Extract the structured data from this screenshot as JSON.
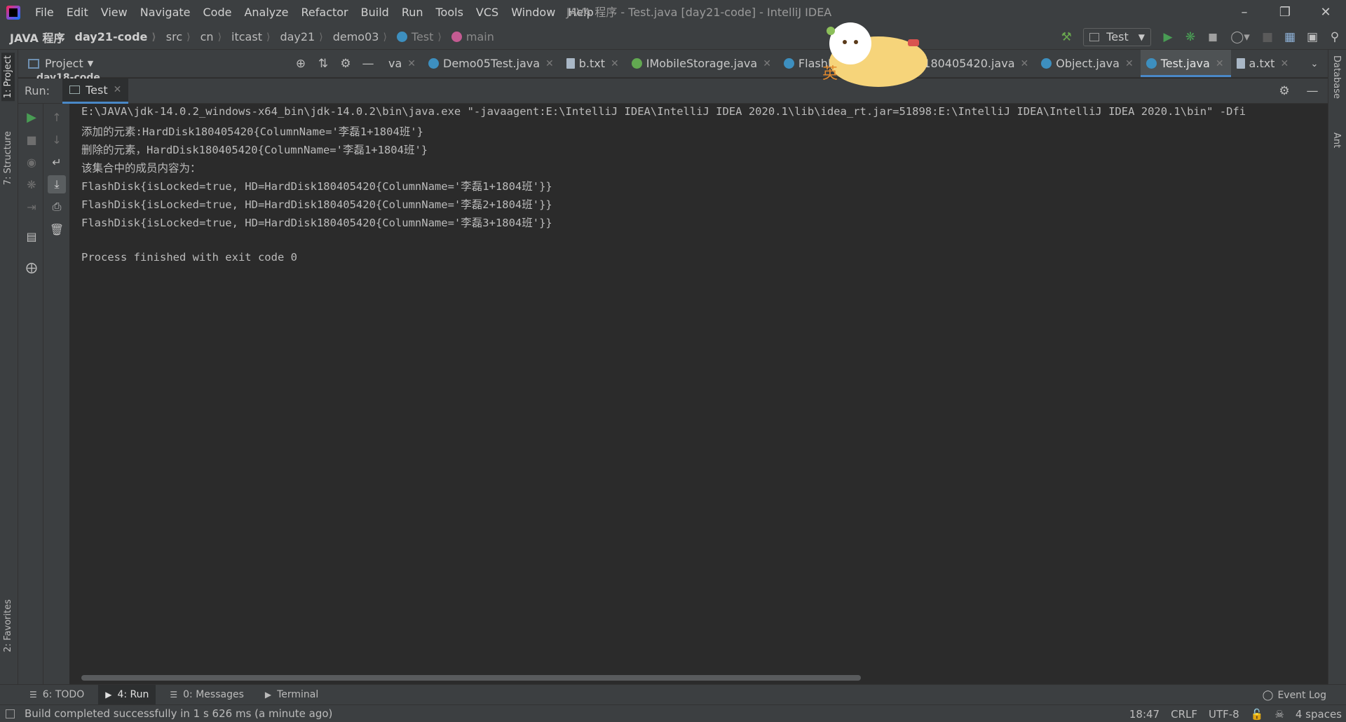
{
  "menu": {
    "items": [
      "File",
      "Edit",
      "View",
      "Navigate",
      "Code",
      "Analyze",
      "Refactor",
      "Build",
      "Run",
      "Tools",
      "VCS",
      "Window",
      "Help"
    ],
    "window_title": "JAVA 程序 - Test.java [day21-code] - IntelliJ IDEA"
  },
  "breadcrumb": {
    "items": [
      "JAVA 程序",
      "day21-code",
      "src",
      "cn",
      "itcast",
      "day21",
      "demo03",
      "Test",
      "main"
    ]
  },
  "run_config": {
    "label": "Test"
  },
  "project_panel": {
    "title": "Project",
    "tree_peek": "day18-code"
  },
  "editor_tabs": [
    {
      "label": "va",
      "icon": "none"
    },
    {
      "label": "Demo05Test.java",
      "icon": "class-icon"
    },
    {
      "label": "b.txt",
      "icon": "text-file-icon"
    },
    {
      "label": "IMobileStorage.java",
      "icon": "interface-icon"
    },
    {
      "label": "FlashDisk",
      "icon": "class-icon"
    },
    {
      "label": "isk180405420.java",
      "icon": "none"
    },
    {
      "label": "Object.java",
      "icon": "class-icon"
    },
    {
      "label": "Test.java",
      "icon": "class-icon",
      "active": true
    },
    {
      "label": "a.txt",
      "icon": "text-file-icon"
    }
  ],
  "run_panel": {
    "label": "Run:",
    "tab": "Test"
  },
  "console": {
    "lines": [
      "E:\\JAVA\\jdk-14.0.2_windows-x64_bin\\jdk-14.0.2\\bin\\java.exe \"-javaagent:E:\\IntelliJ IDEA\\IntelliJ IDEA 2020.1\\lib\\idea_rt.jar=51898:E:\\IntelliJ IDEA\\IntelliJ IDEA 2020.1\\bin\" -Dfi",
      "添加的元素:HardDisk180405420{ColumnName='李磊1+1804班'}",
      "删除的元素，HardDisk180405420{ColumnName='李磊1+1804班'}",
      "该集合中的成员内容为：",
      "FlashDisk{isLocked=true, HD=HardDisk180405420{ColumnName='李磊1+1804班'}}",
      "FlashDisk{isLocked=true, HD=HardDisk180405420{ColumnName='李磊2+1804班'}}",
      "FlashDisk{isLocked=true, HD=HardDisk180405420{ColumnName='李磊3+1804班'}}",
      "",
      "Process finished with exit code 0"
    ]
  },
  "left_stripe": {
    "project": "1: Project",
    "structure": "7: Structure",
    "favorites": "2: Favorites"
  },
  "right_stripe": {
    "database": "Database",
    "ant": "Ant"
  },
  "bottom_tabs": {
    "todo": "6: TODO",
    "run": "4: Run",
    "messages": "0: Messages",
    "terminal": "Terminal",
    "event_log": "Event Log"
  },
  "status": {
    "message": "Build completed successfully in 1 s 626 ms (a minute ago)",
    "position": "18:47",
    "line_sep": "CRLF",
    "encoding": "UTF-8",
    "indent": "4 spaces"
  },
  "sticker": {
    "text": "英"
  },
  "colors": {
    "background": "#2b2b2b",
    "panel": "#3c3f41",
    "accent": "#4a88c7",
    "run_green": "#499c54"
  }
}
